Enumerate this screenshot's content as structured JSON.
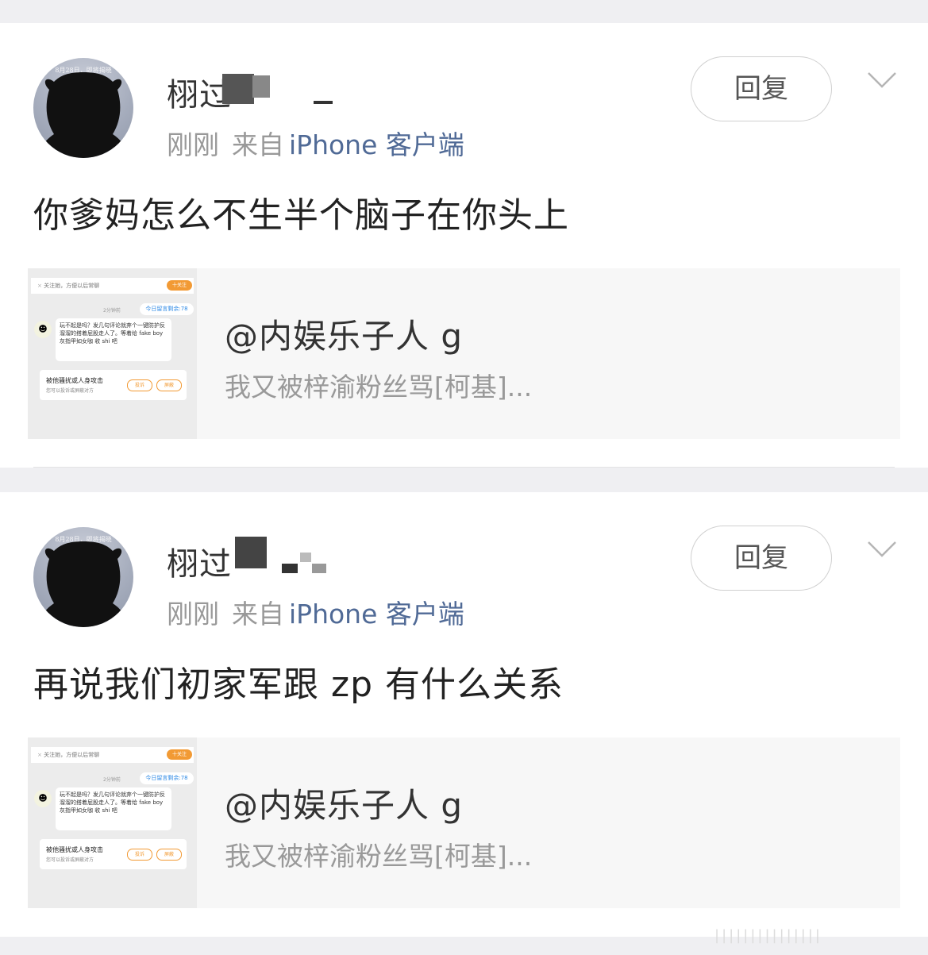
{
  "posts": [
    {
      "avatar_caption": "8月28日，即将揭晓",
      "username": "栩过",
      "time": "刚刚",
      "source_prefix": "来自",
      "source": "iPhone 客户端",
      "reply_label": "回复",
      "content": "你爹妈怎么不生半个脑子在你头上",
      "quote": {
        "title": "@内娱乐子人 g",
        "desc": "我又被梓渝粉丝骂[柯基]...",
        "thumb": {
          "bar_text": "关注她，方便以后常聊",
          "follow": "十关注",
          "time": "2分钟前",
          "tag": "今日留言剩余:78",
          "bubble": "玩不起是吗？发几句评论就弃个一键防护反溜溜的搭着屁股走人了。等着给 fake boy 灰指甲如女咖 收 shi 吧",
          "panel_title": "被他骚扰或人身攻击",
          "panel_sub": "您可以投诉或屏蔽对方",
          "btn1": "投诉",
          "btn2": "屏蔽"
        }
      }
    },
    {
      "avatar_caption": "8月28日，即将揭晓",
      "username": "栩过",
      "time": "刚刚",
      "source_prefix": "来自",
      "source": "iPhone 客户端",
      "reply_label": "回复",
      "content": "再说我们初家军跟 zp 有什么关系",
      "quote": {
        "title": "@内娱乐子人 g",
        "desc": "我又被梓渝粉丝骂[柯基]...",
        "thumb": {
          "bar_text": "关注她，方便以后常聊",
          "follow": "十关注",
          "time": "2分钟前",
          "tag": "今日留言剩余:78",
          "bubble": "玩不起是吗？发几句评论就弃个一键防护反溜溜的搭着屁股走人了。等着给 fake boy 灰指甲如女咖 收 shi 吧",
          "panel_title": "被他骚扰或人身攻击",
          "panel_sub": "您可以投诉或屏蔽对方",
          "btn1": "投诉",
          "btn2": "屏蔽"
        }
      }
    }
  ],
  "watermark": "|||||||||||||||",
  "colors": {
    "link": "#506a96",
    "accent": "#f29a34",
    "bg": "#efeff2"
  }
}
